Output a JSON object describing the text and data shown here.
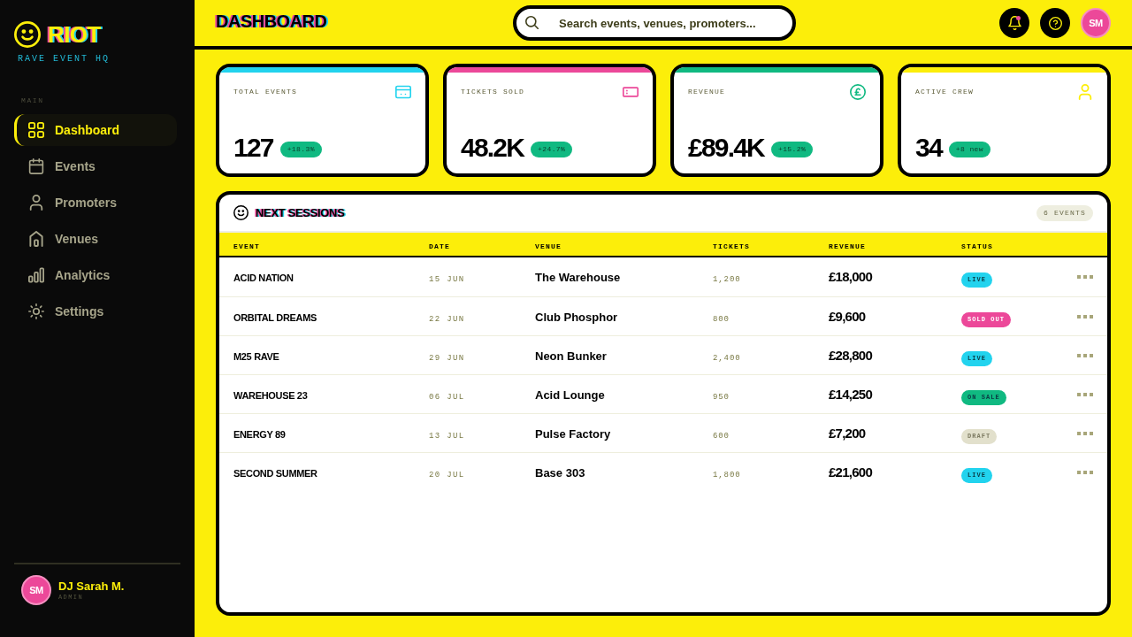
{
  "sidebar": {
    "logo": {
      "text": "RIOT",
      "tagline": "RAVE EVENT HQ"
    },
    "section_label": "MAIN",
    "items": [
      {
        "label": "Dashboard",
        "selected": true
      },
      {
        "label": "Events",
        "selected": false
      },
      {
        "label": "Promoters",
        "selected": false
      },
      {
        "label": "Venues",
        "selected": false
      },
      {
        "label": "Analytics",
        "selected": false
      },
      {
        "label": "Settings",
        "selected": false
      }
    ],
    "user": {
      "initials": "SM",
      "name": "DJ Sarah M.",
      "role": "ADMIN"
    }
  },
  "header": {
    "title": "DASHBOARD",
    "search": {
      "placeholder": "Search events, venues, promoters..."
    },
    "notifications": {
      "unread": true
    },
    "avatar": {
      "initials": "SM"
    }
  },
  "stats": [
    {
      "label": "TOTAL EVENTS",
      "value": "127",
      "change": "+18.3%",
      "color": "#22d3ee"
    },
    {
      "label": "TICKETS SOLD",
      "value": "48.2K",
      "change": "+24.7%",
      "color": "#ec4899"
    },
    {
      "label": "REVENUE",
      "value": "£89.4K",
      "change": "+15.2%",
      "color": "#10b981"
    },
    {
      "label": "ACTIVE CREW",
      "value": "34",
      "change": "+8 new",
      "color": "#fcee0a"
    }
  ],
  "sessions": {
    "title": "NEXT SESSIONS",
    "count": "6 EVENTS",
    "table": {
      "columns": [
        "EVENT",
        "DATE",
        "VENUE",
        "TICKETS",
        "REVENUE",
        "STATUS"
      ],
      "rows": [
        {
          "event": "ACID NATION",
          "date": "15 JUN",
          "venue": "The Warehouse",
          "tickets": "1,200",
          "revenue": "£18,000",
          "status": {
            "label": "LIVE",
            "color": "#22d3ee"
          }
        },
        {
          "event": "ORBITAL DREAMS",
          "date": "22 JUN",
          "venue": "Club Phosphor",
          "tickets": "800",
          "revenue": "£9,600",
          "status": {
            "label": "SOLD OUT",
            "color": "#ec4899"
          }
        },
        {
          "event": "M25 RAVE",
          "date": "29 JUN",
          "venue": "Neon Bunker",
          "tickets": "2,400",
          "revenue": "£28,800",
          "status": {
            "label": "LIVE",
            "color": "#22d3ee"
          }
        },
        {
          "event": "WAREHOUSE 23",
          "date": "06 JUL",
          "venue": "Acid Lounge",
          "tickets": "950",
          "revenue": "£14,250",
          "status": {
            "label": "ON SALE",
            "color": "#10b981"
          }
        },
        {
          "event": "ENERGY 89",
          "date": "13 JUL",
          "venue": "Pulse Factory",
          "tickets": "600",
          "revenue": "£7,200",
          "status": {
            "label": "DRAFT",
            "color": "#e2e0cc"
          }
        },
        {
          "event": "SECOND SUMMER",
          "date": "20 JUL",
          "venue": "Base 303",
          "tickets": "1,800",
          "revenue": "£21,600",
          "status": {
            "label": "LIVE",
            "color": "#22d3ee"
          }
        }
      ]
    }
  }
}
